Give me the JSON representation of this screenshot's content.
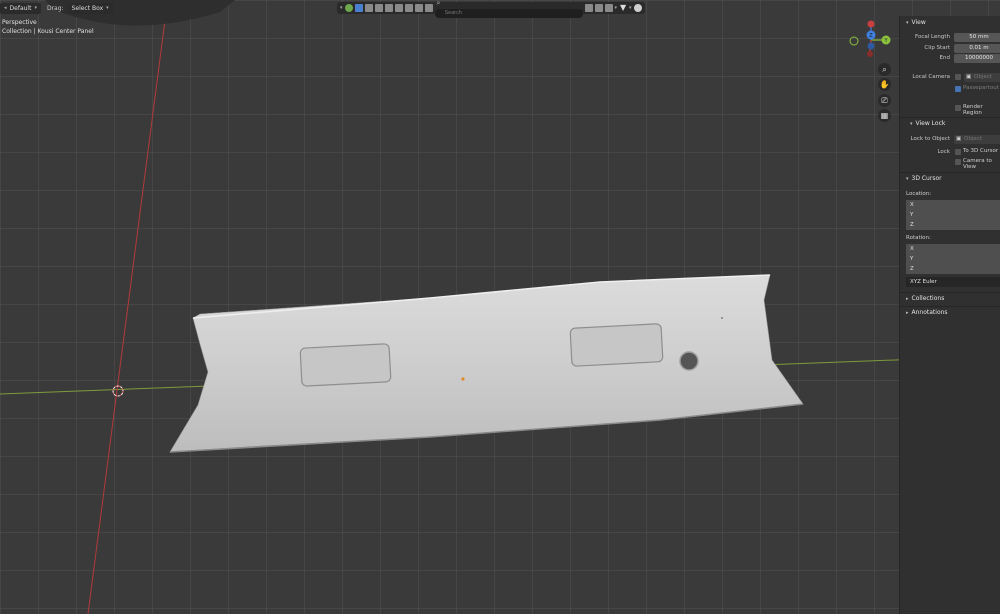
{
  "header": {
    "mode_dropdown": "Default",
    "drag_label": "Drag:",
    "drag_dropdown": "Select Box",
    "search_placeholder": "Search"
  },
  "viewport_overlay": {
    "view_name": "Perspective",
    "collection_path": "Collection | Kousi Center Panel"
  },
  "gizmo": {
    "x_label": "X",
    "y_label": "Y",
    "z_label": "Z"
  },
  "sidebar": {
    "view": {
      "title": "View",
      "focal_length_label": "Focal Length",
      "focal_length_value": "50 mm",
      "clip_start_label": "Clip Start",
      "clip_start_value": "0.01 m",
      "end_label": "End",
      "end_value": "10000000",
      "local_camera_label": "Local Camera",
      "local_camera_value": "Object",
      "passepartout_label": "Passepartout",
      "render_region_label": "Render Region"
    },
    "view_lock": {
      "title": "View Lock",
      "lock_to_object_label": "Lock to Object",
      "lock_to_object_value": "Object",
      "lock_label": "Lock",
      "to_3d_cursor_label": "To 3D Cursor",
      "camera_to_view_label": "Camera to View"
    },
    "cursor": {
      "title": "3D Cursor",
      "location_label": "Location:",
      "location": [
        "X",
        "Y",
        "Z"
      ],
      "rotation_label": "Rotation:",
      "rotation": [
        "X",
        "Y",
        "Z"
      ],
      "rotation_mode": "XYZ Euler"
    },
    "collections_title": "Collections",
    "annotations_title": "Annotations"
  },
  "colors": {
    "x_axis": "#c7403f",
    "y_axis": "#8bc23d",
    "z_axis": "#3f7fe0",
    "accent": "#4772b3"
  }
}
